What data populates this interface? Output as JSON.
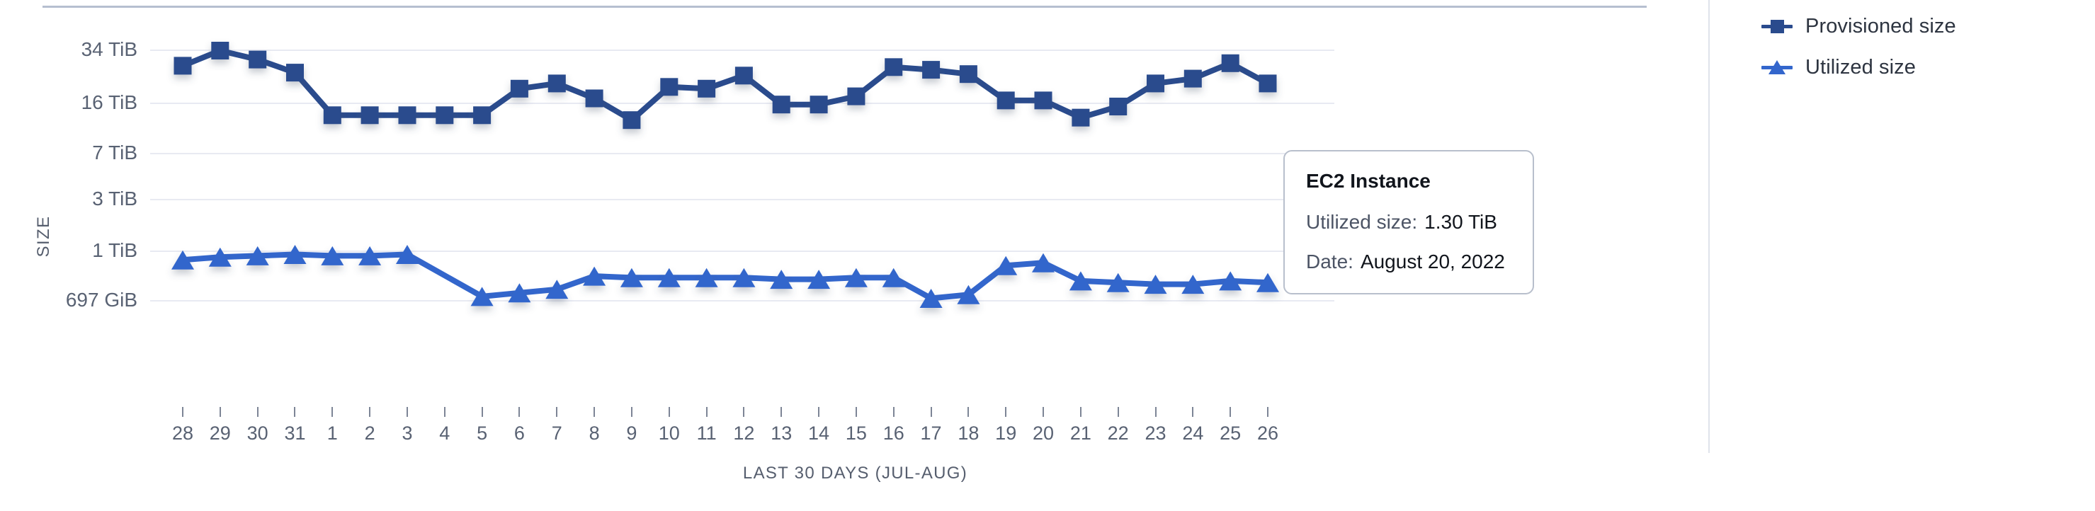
{
  "legend": {
    "position": "right",
    "items": [
      {
        "label": "Provisioned size",
        "marker": "square-marker-icon",
        "color": "#2a4b8d"
      },
      {
        "label": "Utilized size",
        "marker": "triangle-marker-icon",
        "color": "#3366cc"
      }
    ]
  },
  "tooltip": {
    "title": "EC2 Instance",
    "metric_label": "Utilized size:",
    "metric_value": "1.30 TiB",
    "date_label": "Date:",
    "date_value": "August 20, 2022"
  },
  "chart_data": {
    "type": "line",
    "title": "",
    "xlabel": "LAST 30 DAYS (JUL-AUG)",
    "ylabel": "SIZE",
    "grid": true,
    "legend_position": "right",
    "yscale": "log",
    "ytick_labels": [
      "34 TiB",
      "16 TiB",
      "7 TiB",
      "3 TiB",
      "1 TiB",
      "697 GiB"
    ],
    "ytick_values": [
      34,
      16,
      7,
      3,
      1,
      0.6807
    ],
    "ylim": [
      0.6807,
      40
    ],
    "categories": [
      "28",
      "29",
      "30",
      "31",
      "1",
      "2",
      "3",
      "4",
      "5",
      "6",
      "7",
      "8",
      "9",
      "10",
      "11",
      "12",
      "13",
      "14",
      "15",
      "16",
      "17",
      "18",
      "19",
      "20",
      "21",
      "22",
      "23",
      "24",
      "25",
      "26"
    ],
    "series": [
      {
        "name": "Provisioned size",
        "color": "#2a4b8d",
        "marker": "square",
        "unit": "TiB",
        "values": [
          27.0,
          33.5,
          29.5,
          24.5,
          13.0,
          13.0,
          13.0,
          13.0,
          13.0,
          19.5,
          21.0,
          17.0,
          12.0,
          20.0,
          19.5,
          23.5,
          15.5,
          15.5,
          17.5,
          26.5,
          25.5,
          24.0,
          16.5,
          16.5,
          12.5,
          15.0,
          21.0,
          22.5,
          28.0,
          21.0
        ]
      },
      {
        "name": "Utilized size",
        "color": "#3366cc",
        "marker": "triangle",
        "unit": "TiB",
        "values": [
          0.93,
          0.95,
          0.96,
          0.97,
          0.96,
          0.96,
          0.97,
          null,
          0.7,
          0.72,
          0.74,
          0.82,
          0.81,
          0.81,
          0.81,
          0.81,
          0.8,
          0.8,
          0.81,
          0.81,
          0.69,
          0.71,
          0.89,
          0.91,
          0.79,
          0.78,
          0.77,
          0.77,
          0.79,
          0.78
        ]
      }
    ]
  }
}
